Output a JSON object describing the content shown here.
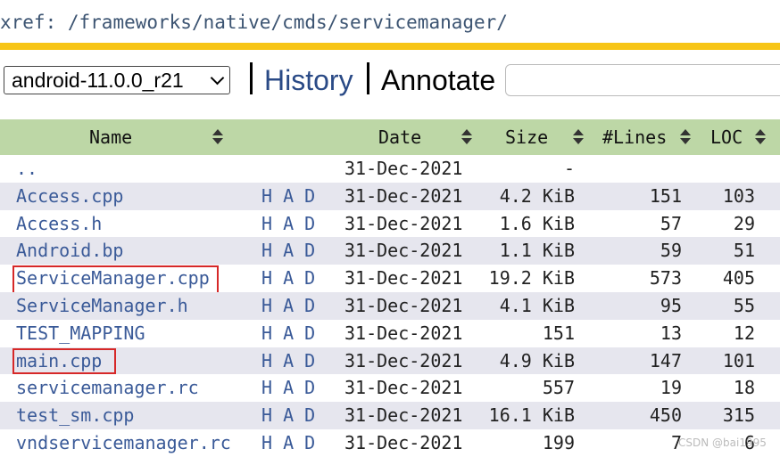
{
  "xref": {
    "label": "xref:",
    "path": "/frameworks/native/cmds/servicemanager/"
  },
  "toolbar": {
    "version": "android-11.0.0_r21",
    "history": "History",
    "annotate": "Annotate",
    "search_value": ""
  },
  "table": {
    "headers": [
      "Name",
      "Date",
      "Size",
      "#Lines",
      "LOC"
    ],
    "rows": [
      {
        "name": "..",
        "had": "",
        "date": "31-Dec-2021",
        "size": "-",
        "lines": "",
        "loc": ""
      },
      {
        "name": "Access.cpp",
        "had": "H A D",
        "date": "31-Dec-2021",
        "size": "4.2 KiB",
        "lines": "151",
        "loc": "103"
      },
      {
        "name": "Access.h",
        "had": "H A D",
        "date": "31-Dec-2021",
        "size": "1.6 KiB",
        "lines": "57",
        "loc": "29"
      },
      {
        "name": "Android.bp",
        "had": "H A D",
        "date": "31-Dec-2021",
        "size": "1.1 KiB",
        "lines": "59",
        "loc": "51"
      },
      {
        "name": "ServiceManager.cpp",
        "had": "H A D",
        "date": "31-Dec-2021",
        "size": "19.2 KiB",
        "lines": "573",
        "loc": "405"
      },
      {
        "name": "ServiceManager.h",
        "had": "H A D",
        "date": "31-Dec-2021",
        "size": "4.1 KiB",
        "lines": "95",
        "loc": "55"
      },
      {
        "name": "TEST_MAPPING",
        "had": "H A D",
        "date": "31-Dec-2021",
        "size": "151",
        "lines": "13",
        "loc": "12"
      },
      {
        "name": "main.cpp",
        "had": "H A D",
        "date": "31-Dec-2021",
        "size": "4.9 KiB",
        "lines": "147",
        "loc": "101"
      },
      {
        "name": "servicemanager.rc",
        "had": "H A D",
        "date": "31-Dec-2021",
        "size": "557",
        "lines": "19",
        "loc": "18"
      },
      {
        "name": "test_sm.cpp",
        "had": "H A D",
        "date": "31-Dec-2021",
        "size": "16.1 KiB",
        "lines": "450",
        "loc": "315"
      },
      {
        "name": "vndservicemanager.rc",
        "had": "H A D",
        "date": "31-Dec-2021",
        "size": "199",
        "lines": "7",
        "loc": "6"
      }
    ]
  },
  "watermark": "CSDN @bai1995",
  "colors": {
    "accent_bar": "#f7c517",
    "header_bg": "#bdd7a6",
    "link": "#3a5a98",
    "highlight": "#d62828"
  }
}
